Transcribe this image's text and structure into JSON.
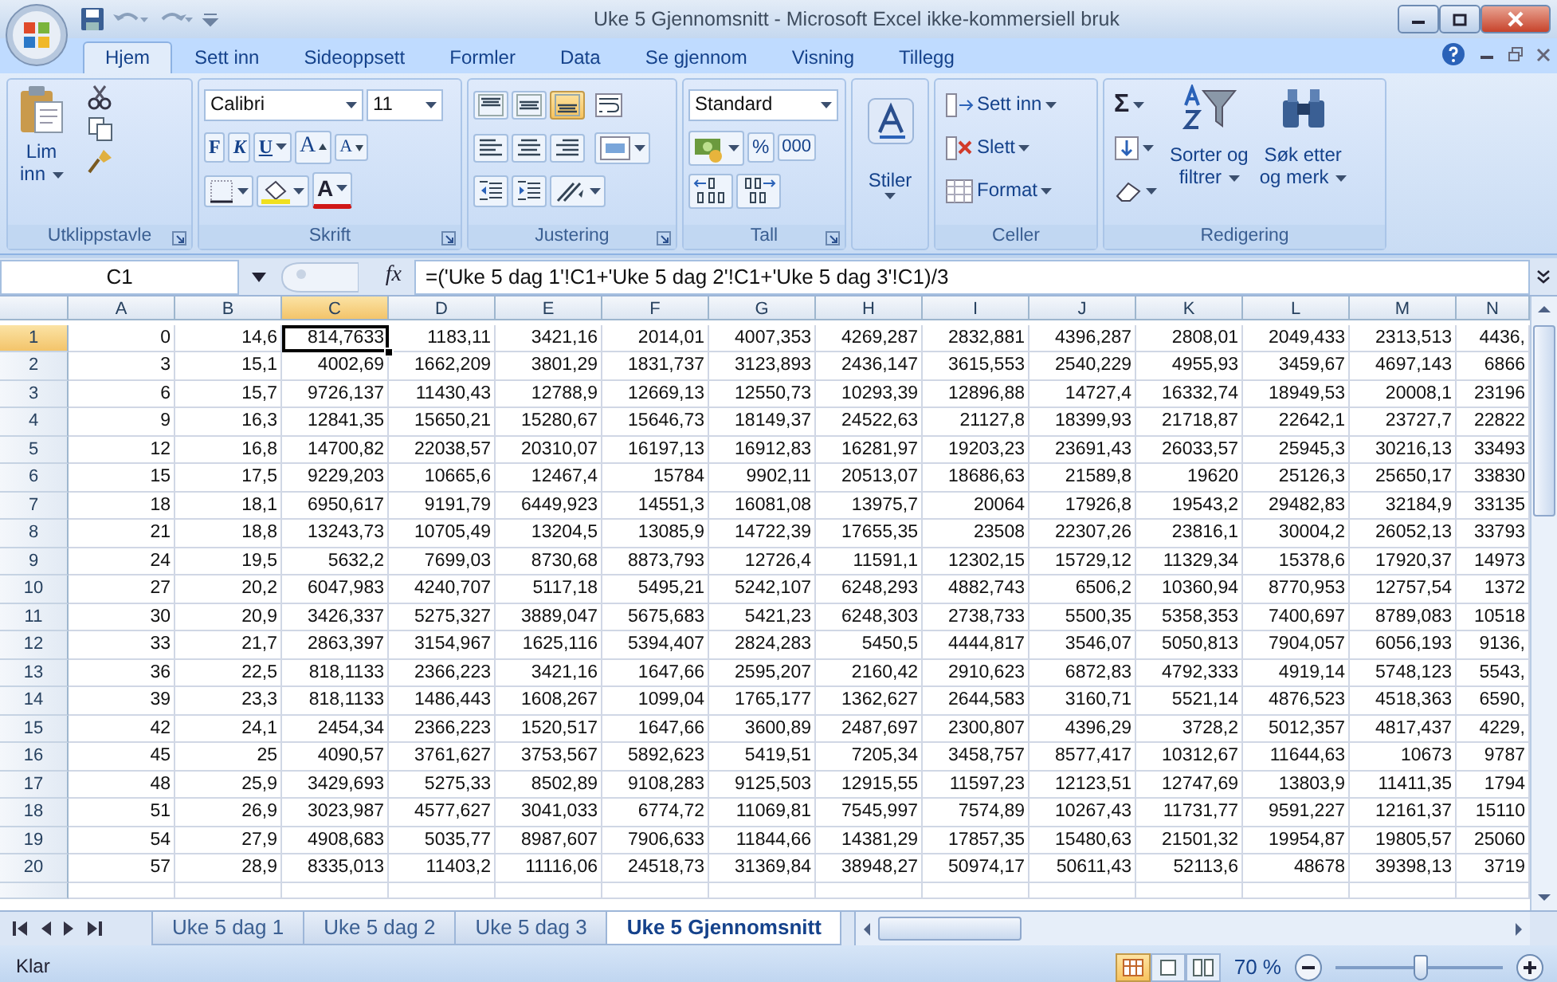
{
  "window": {
    "title": "Uke 5 Gjennomsnitt - Microsoft Excel ikke-kommersiell bruk"
  },
  "ribbon_tabs": [
    {
      "label": "Hjem",
      "selected": true
    },
    {
      "label": "Sett inn",
      "selected": false
    },
    {
      "label": "Sideoppsett",
      "selected": false
    },
    {
      "label": "Formler",
      "selected": false
    },
    {
      "label": "Data",
      "selected": false
    },
    {
      "label": "Se gjennom",
      "selected": false
    },
    {
      "label": "Visning",
      "selected": false
    },
    {
      "label": "Tillegg",
      "selected": false
    }
  ],
  "ribbon_groups": [
    {
      "kind": "clipboard",
      "label": "Utklippstavle",
      "paste_lines": [
        "Lim",
        "inn"
      ]
    },
    {
      "kind": "font",
      "label": "Skrift",
      "font_name": "Calibri",
      "font_size": "11",
      "bold": "F",
      "italic": "K",
      "underline": "U",
      "grow": "A",
      "shrink": "A",
      "font_color": "A"
    },
    {
      "kind": "alignment",
      "label": "Justering",
      "vertical_buttons": [
        {
          "kind": "top",
          "selected": false
        },
        {
          "kind": "middle",
          "selected": false
        },
        {
          "kind": "bottom",
          "selected": true
        }
      ]
    },
    {
      "kind": "number",
      "label": "Tall",
      "format": "Standard",
      "percent": "%",
      "thousands": "000"
    },
    {
      "kind": "styles",
      "button": "Stiler"
    },
    {
      "kind": "cells",
      "label": "Celler",
      "commands": [
        "Sett inn",
        "Slett",
        "Format"
      ]
    },
    {
      "kind": "editing",
      "label": "Redigering",
      "sum": "Σ",
      "sort_lines": [
        "Sorter og",
        "filtrer"
      ],
      "find_lines": [
        "Søk etter",
        "og merk"
      ]
    }
  ],
  "formula_bar": {
    "name_box": "C1",
    "fx": "fx",
    "formula": "=('Uke 5 dag 1'!C1+'Uke 5 dag 2'!C1+'Uke 5 dag 3'!C1)/3"
  },
  "columns": [
    {
      "label": "A",
      "selected": false
    },
    {
      "label": "B",
      "selected": false
    },
    {
      "label": "C",
      "selected": true
    },
    {
      "label": "D",
      "selected": false
    },
    {
      "label": "E",
      "selected": false
    },
    {
      "label": "F",
      "selected": false
    },
    {
      "label": "G",
      "selected": false
    },
    {
      "label": "H",
      "selected": false
    },
    {
      "label": "I",
      "selected": false
    },
    {
      "label": "J",
      "selected": false
    },
    {
      "label": "K",
      "selected": false
    },
    {
      "label": "L",
      "selected": false
    },
    {
      "label": "M",
      "selected": false
    },
    {
      "label": "N",
      "selected": false
    }
  ],
  "rows": [
    {
      "label": "1",
      "selected": true,
      "cells": [
        "0",
        "14,6",
        "814,7633",
        "1183,11",
        "3421,16",
        "2014,01",
        "4007,353",
        "4269,287",
        "2832,881",
        "4396,287",
        "2808,01",
        "2049,433",
        "2313,513",
        "4436,"
      ]
    },
    {
      "label": "2",
      "selected": false,
      "cells": [
        "3",
        "15,1",
        "4002,69",
        "1662,209",
        "3801,29",
        "1831,737",
        "3123,893",
        "2436,147",
        "3615,553",
        "2540,229",
        "4955,93",
        "3459,67",
        "4697,143",
        "6866"
      ]
    },
    {
      "label": "3",
      "selected": false,
      "cells": [
        "6",
        "15,7",
        "9726,137",
        "11430,43",
        "12788,9",
        "12669,13",
        "12550,73",
        "10293,39",
        "12896,88",
        "14727,4",
        "16332,74",
        "18949,53",
        "20008,1",
        "23196"
      ]
    },
    {
      "label": "4",
      "selected": false,
      "cells": [
        "9",
        "16,3",
        "12841,35",
        "15650,21",
        "15280,67",
        "15646,73",
        "18149,37",
        "24522,63",
        "21127,8",
        "18399,93",
        "21718,87",
        "22642,1",
        "23727,7",
        "22822"
      ]
    },
    {
      "label": "5",
      "selected": false,
      "cells": [
        "12",
        "16,8",
        "14700,82",
        "22038,57",
        "20310,07",
        "16197,13",
        "16912,83",
        "16281,97",
        "19203,23",
        "23691,43",
        "26033,57",
        "25945,3",
        "30216,13",
        "33493"
      ]
    },
    {
      "label": "6",
      "selected": false,
      "cells": [
        "15",
        "17,5",
        "9229,203",
        "10665,6",
        "12467,4",
        "15784",
        "9902,11",
        "20513,07",
        "18686,63",
        "21589,8",
        "19620",
        "25126,3",
        "25650,17",
        "33830"
      ]
    },
    {
      "label": "7",
      "selected": false,
      "cells": [
        "18",
        "18,1",
        "6950,617",
        "9191,79",
        "6449,923",
        "14551,3",
        "16081,08",
        "13975,7",
        "20064",
        "17926,8",
        "19543,2",
        "29482,83",
        "32184,9",
        "33135"
      ]
    },
    {
      "label": "8",
      "selected": false,
      "cells": [
        "21",
        "18,8",
        "13243,73",
        "10705,49",
        "13204,5",
        "13085,9",
        "14722,39",
        "17655,35",
        "23508",
        "22307,26",
        "23816,1",
        "30004,2",
        "26052,13",
        "33793"
      ]
    },
    {
      "label": "9",
      "selected": false,
      "cells": [
        "24",
        "19,5",
        "5632,2",
        "7699,03",
        "8730,68",
        "8873,793",
        "12726,4",
        "11591,1",
        "12302,15",
        "15729,12",
        "11329,34",
        "15378,6",
        "17920,37",
        "14973"
      ]
    },
    {
      "label": "10",
      "selected": false,
      "cells": [
        "27",
        "20,2",
        "6047,983",
        "4240,707",
        "5117,18",
        "5495,21",
        "5242,107",
        "6248,293",
        "4882,743",
        "6506,2",
        "10360,94",
        "8770,953",
        "12757,54",
        "1372"
      ]
    },
    {
      "label": "11",
      "selected": false,
      "cells": [
        "30",
        "20,9",
        "3426,337",
        "5275,327",
        "3889,047",
        "5675,683",
        "5421,23",
        "6248,303",
        "2738,733",
        "5500,35",
        "5358,353",
        "7400,697",
        "8789,083",
        "10518"
      ]
    },
    {
      "label": "12",
      "selected": false,
      "cells": [
        "33",
        "21,7",
        "2863,397",
        "3154,967",
        "1625,116",
        "5394,407",
        "2824,283",
        "5450,5",
        "4444,817",
        "3546,07",
        "5050,813",
        "7904,057",
        "6056,193",
        "9136,"
      ]
    },
    {
      "label": "13",
      "selected": false,
      "cells": [
        "36",
        "22,5",
        "818,1133",
        "2366,223",
        "3421,16",
        "1647,66",
        "2595,207",
        "2160,42",
        "2910,623",
        "6872,83",
        "4792,333",
        "4919,14",
        "5748,123",
        "5543,"
      ]
    },
    {
      "label": "14",
      "selected": false,
      "cells": [
        "39",
        "23,3",
        "818,1133",
        "1486,443",
        "1608,267",
        "1099,04",
        "1765,177",
        "1362,627",
        "2644,583",
        "3160,71",
        "5521,14",
        "4876,523",
        "4518,363",
        "6590,"
      ]
    },
    {
      "label": "15",
      "selected": false,
      "cells": [
        "42",
        "24,1",
        "2454,34",
        "2366,223",
        "1520,517",
        "1647,66",
        "3600,89",
        "2487,697",
        "2300,807",
        "4396,29",
        "3728,2",
        "5012,357",
        "4817,437",
        "4229,"
      ]
    },
    {
      "label": "16",
      "selected": false,
      "cells": [
        "45",
        "25",
        "4090,57",
        "3761,627",
        "3753,567",
        "5892,623",
        "5419,51",
        "7205,34",
        "3458,757",
        "8577,417",
        "10312,67",
        "11644,63",
        "10673",
        "9787"
      ]
    },
    {
      "label": "17",
      "selected": false,
      "cells": [
        "48",
        "25,9",
        "3429,693",
        "5275,33",
        "8502,89",
        "9108,283",
        "9125,503",
        "12915,55",
        "11597,23",
        "12123,51",
        "12747,69",
        "13803,9",
        "11411,35",
        "1794"
      ]
    },
    {
      "label": "18",
      "selected": false,
      "cells": [
        "51",
        "26,9",
        "3023,987",
        "4577,627",
        "3041,033",
        "6774,72",
        "11069,81",
        "7545,997",
        "7574,89",
        "10267,43",
        "11731,77",
        "9591,227",
        "12161,37",
        "15110"
      ]
    },
    {
      "label": "19",
      "selected": false,
      "cells": [
        "54",
        "27,9",
        "4908,683",
        "5035,77",
        "8987,607",
        "7906,633",
        "11844,66",
        "14381,29",
        "17857,35",
        "15480,63",
        "21501,32",
        "19954,87",
        "19805,57",
        "25060"
      ]
    },
    {
      "label": "20",
      "selected": false,
      "cells": [
        "57",
        "28,9",
        "8335,013",
        "11403,2",
        "11116,06",
        "24518,73",
        "31369,84",
        "38948,27",
        "50974,17",
        "50611,43",
        "52113,6",
        "48678",
        "39398,13",
        "3719"
      ]
    }
  ],
  "sheet_tabs": [
    {
      "label": "Uke 5 dag 1",
      "selected": false
    },
    {
      "label": "Uke 5 dag 2",
      "selected": false
    },
    {
      "label": "Uke 5 dag 3",
      "selected": false
    },
    {
      "label": "Uke 5 Gjennomsnitt",
      "selected": true
    }
  ],
  "status_bar": {
    "status": "Klar",
    "view_buttons": [
      {
        "kind": "normal",
        "selected": true
      },
      {
        "kind": "layout",
        "selected": false
      },
      {
        "kind": "pagebreak",
        "selected": false
      }
    ],
    "zoom_text": "70 %",
    "zoom_slider": {
      "level": 0.5
    }
  }
}
